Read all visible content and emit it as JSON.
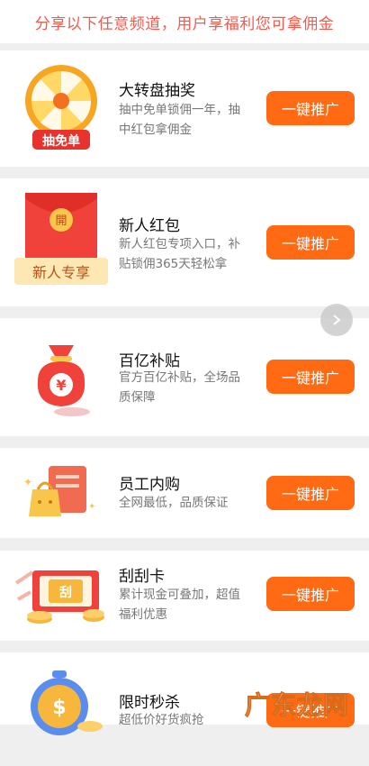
{
  "banner": {
    "text": "分享以下任意频道，用户享福利您可拿佣金"
  },
  "cards": [
    {
      "title": "大转盘抽奖",
      "desc": "抽中免单锁佣一年，抽中红包拿佣金",
      "button": "一键推广",
      "badge": "抽免单"
    },
    {
      "title": "新人红包",
      "desc": "新人红包专项入口，补贴锁佣365天轻松拿",
      "button": "一键推广",
      "badge": "新人专享",
      "envelope_char": "開"
    },
    {
      "title": "百亿补贴",
      "desc": "官方百亿补贴，全场品质保障",
      "button": "一键推广",
      "bag_char": "¥"
    },
    {
      "title": "员工内购",
      "desc": "全网最低，品质保证",
      "button": "一键推广"
    },
    {
      "title": "刮刮卡",
      "desc": "累计现金可叠加，超值福利优惠",
      "button": "一键推广",
      "card_char": "刮"
    },
    {
      "title": "限时秒杀",
      "desc": "超低价好货疯抢",
      "button": "一键推广",
      "coin_char": "$"
    }
  ],
  "watermark": {
    "text": "广东龙网"
  },
  "colors": {
    "accent": "#ff6a12",
    "banner_text": "#f25a4c",
    "red": "#f0413a",
    "gold": "#f6b73c"
  }
}
